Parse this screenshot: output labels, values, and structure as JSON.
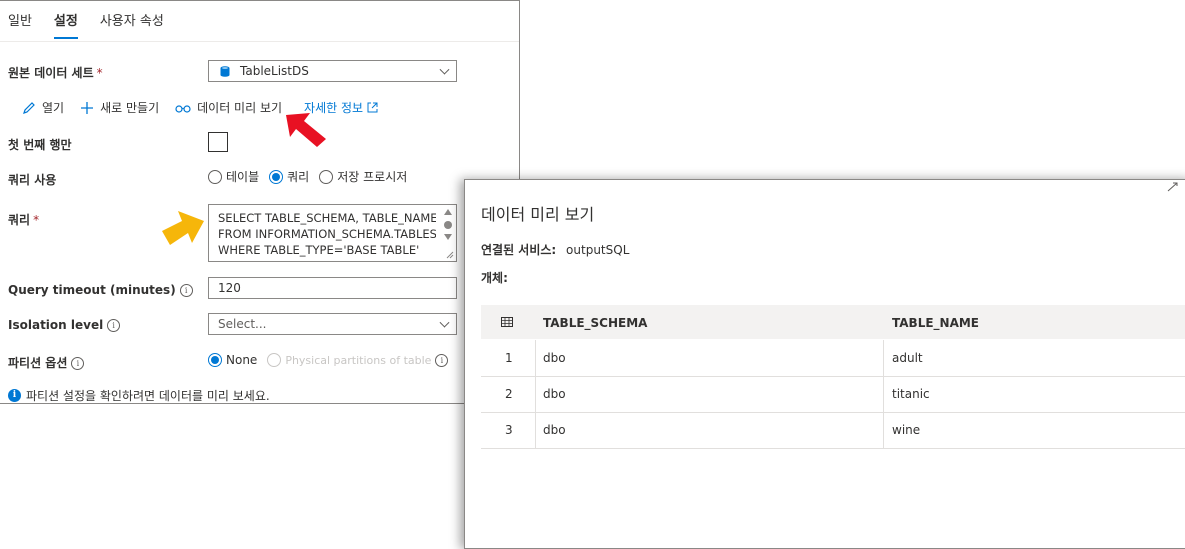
{
  "tabs": [
    "일반",
    "설정",
    "사용자 속성"
  ],
  "source_dataset": {
    "label": "원본 데이터 세트",
    "required": "*",
    "value": "TableListDS"
  },
  "toolbar": {
    "open": "열기",
    "new": "새로 만들기",
    "preview": "데이터 미리 보기",
    "details": "자세한 정보"
  },
  "first_row_only": {
    "label": "첫 번째 행만"
  },
  "use_query": {
    "label": "쿼리 사용",
    "options": [
      "테이블",
      "쿼리",
      "저장 프로시저"
    ],
    "selected": "쿼리"
  },
  "query": {
    "label": "쿼리",
    "required": "*",
    "lines": [
      "SELECT TABLE_SCHEMA, TABLE_NAME",
      "FROM INFORMATION_SCHEMA.TABLES",
      "WHERE TABLE_TYPE='BASE TABLE'"
    ]
  },
  "query_timeout": {
    "label": "Query timeout (minutes)",
    "value": "120"
  },
  "isolation_level": {
    "label": "Isolation level",
    "placeholder": "Select..."
  },
  "partition": {
    "label": "파티션 옵션",
    "options": [
      "None",
      "Physical partitions of table"
    ],
    "selected": "None"
  },
  "info_message": "파티션 설정을 확인하려면 데이터를 미리 보세요.",
  "preview": {
    "title": "데이터 미리 보기",
    "linked_service_label": "연결된 서비스:",
    "linked_service_value": "outputSQL",
    "object_label": "개체:",
    "columns": [
      "TABLE_SCHEMA",
      "TABLE_NAME"
    ],
    "rows": [
      {
        "n": "1",
        "schema": "dbo",
        "name": "adult"
      },
      {
        "n": "2",
        "schema": "dbo",
        "name": "titanic"
      },
      {
        "n": "3",
        "schema": "dbo",
        "name": "wine"
      }
    ]
  },
  "colors": {
    "accent": "#0078d4",
    "arrow_red": "#e81123",
    "arrow_yellow": "#f6b60a"
  }
}
